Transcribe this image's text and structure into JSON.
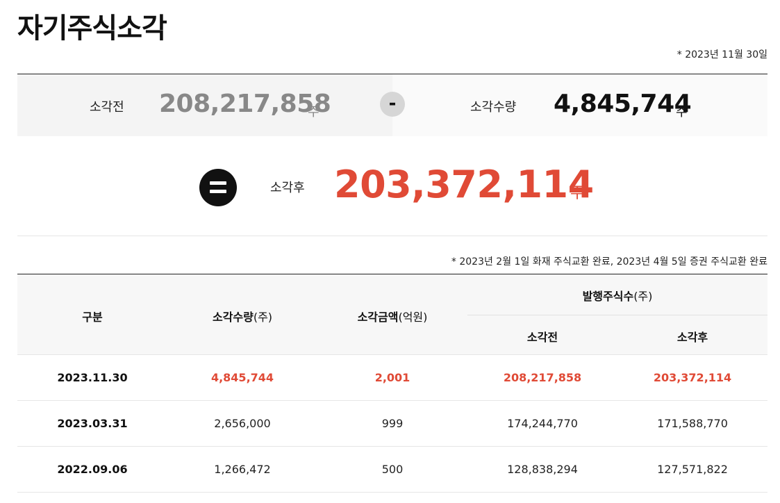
{
  "title": "자기주식소각",
  "base_date": "* 2023년 11월 30일",
  "summary": {
    "before_label": "소각전",
    "before_value": "208,217,858",
    "minus_symbol": "-",
    "qty_label": "소각수량",
    "qty_value": "4,845,744",
    "after_label": "소각후",
    "after_value": "203,372,114",
    "unit": "주"
  },
  "note": "* 2023년 2월 1일 화재 주식교환 완료, 2023년 4월 5일 증권 주식교환 완료",
  "table": {
    "headers": {
      "category": "구분",
      "qty_main": "소각수량",
      "qty_unit": "(주)",
      "amount_main": "소각금액",
      "amount_unit": "(억원)",
      "issued_main": "발행주식수",
      "issued_unit": "(주)",
      "before": "소각전",
      "after": "소각후"
    },
    "rows": [
      {
        "date": "2023.11.30",
        "qty": "4,845,744",
        "amount": "2,001",
        "before": "208,217,858",
        "after": "203,372,114"
      },
      {
        "date": "2023.03.31",
        "qty": "2,656,000",
        "amount": "999",
        "before": "174,244,770",
        "after": "171,588,770"
      },
      {
        "date": "2022.09.06",
        "qty": "1,266,472",
        "amount": "500",
        "before": "128,838,294",
        "after": "127,571,822"
      }
    ]
  },
  "colors": {
    "accent_red": "#e04a36",
    "before_value_gray": "#888888"
  }
}
